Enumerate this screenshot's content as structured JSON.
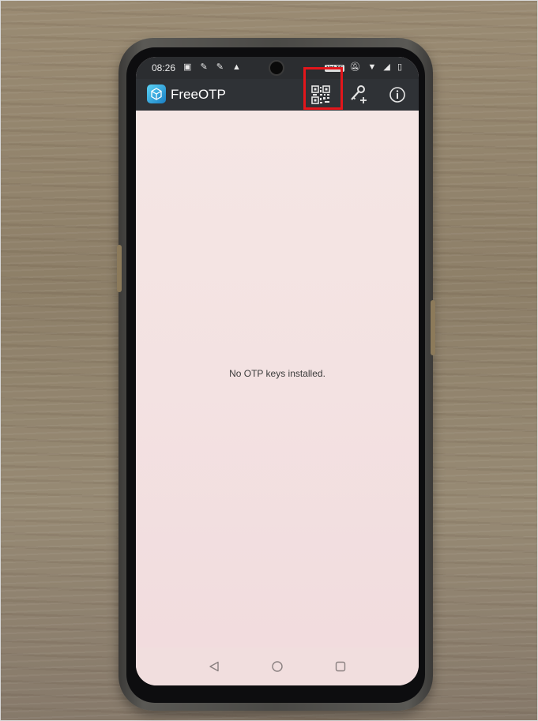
{
  "status_bar": {
    "time": "08:26",
    "volte_label": "VoLTE"
  },
  "app_bar": {
    "title": "FreeOTP",
    "icons": [
      "cube-logo-icon",
      "qr-code-icon",
      "add-key-icon",
      "info-icon"
    ]
  },
  "content": {
    "empty_message": "No OTP keys installed."
  },
  "nav_bar": {
    "icons": [
      "back-triangle-icon",
      "home-circle-icon",
      "recents-square-icon"
    ]
  },
  "colors": {
    "app_bar": "#2f3236",
    "status_bar": "#2b2d30",
    "screen_background": "#f5e6e4",
    "highlight": "#e3161b",
    "logo_accent": "#1a7fc4"
  }
}
